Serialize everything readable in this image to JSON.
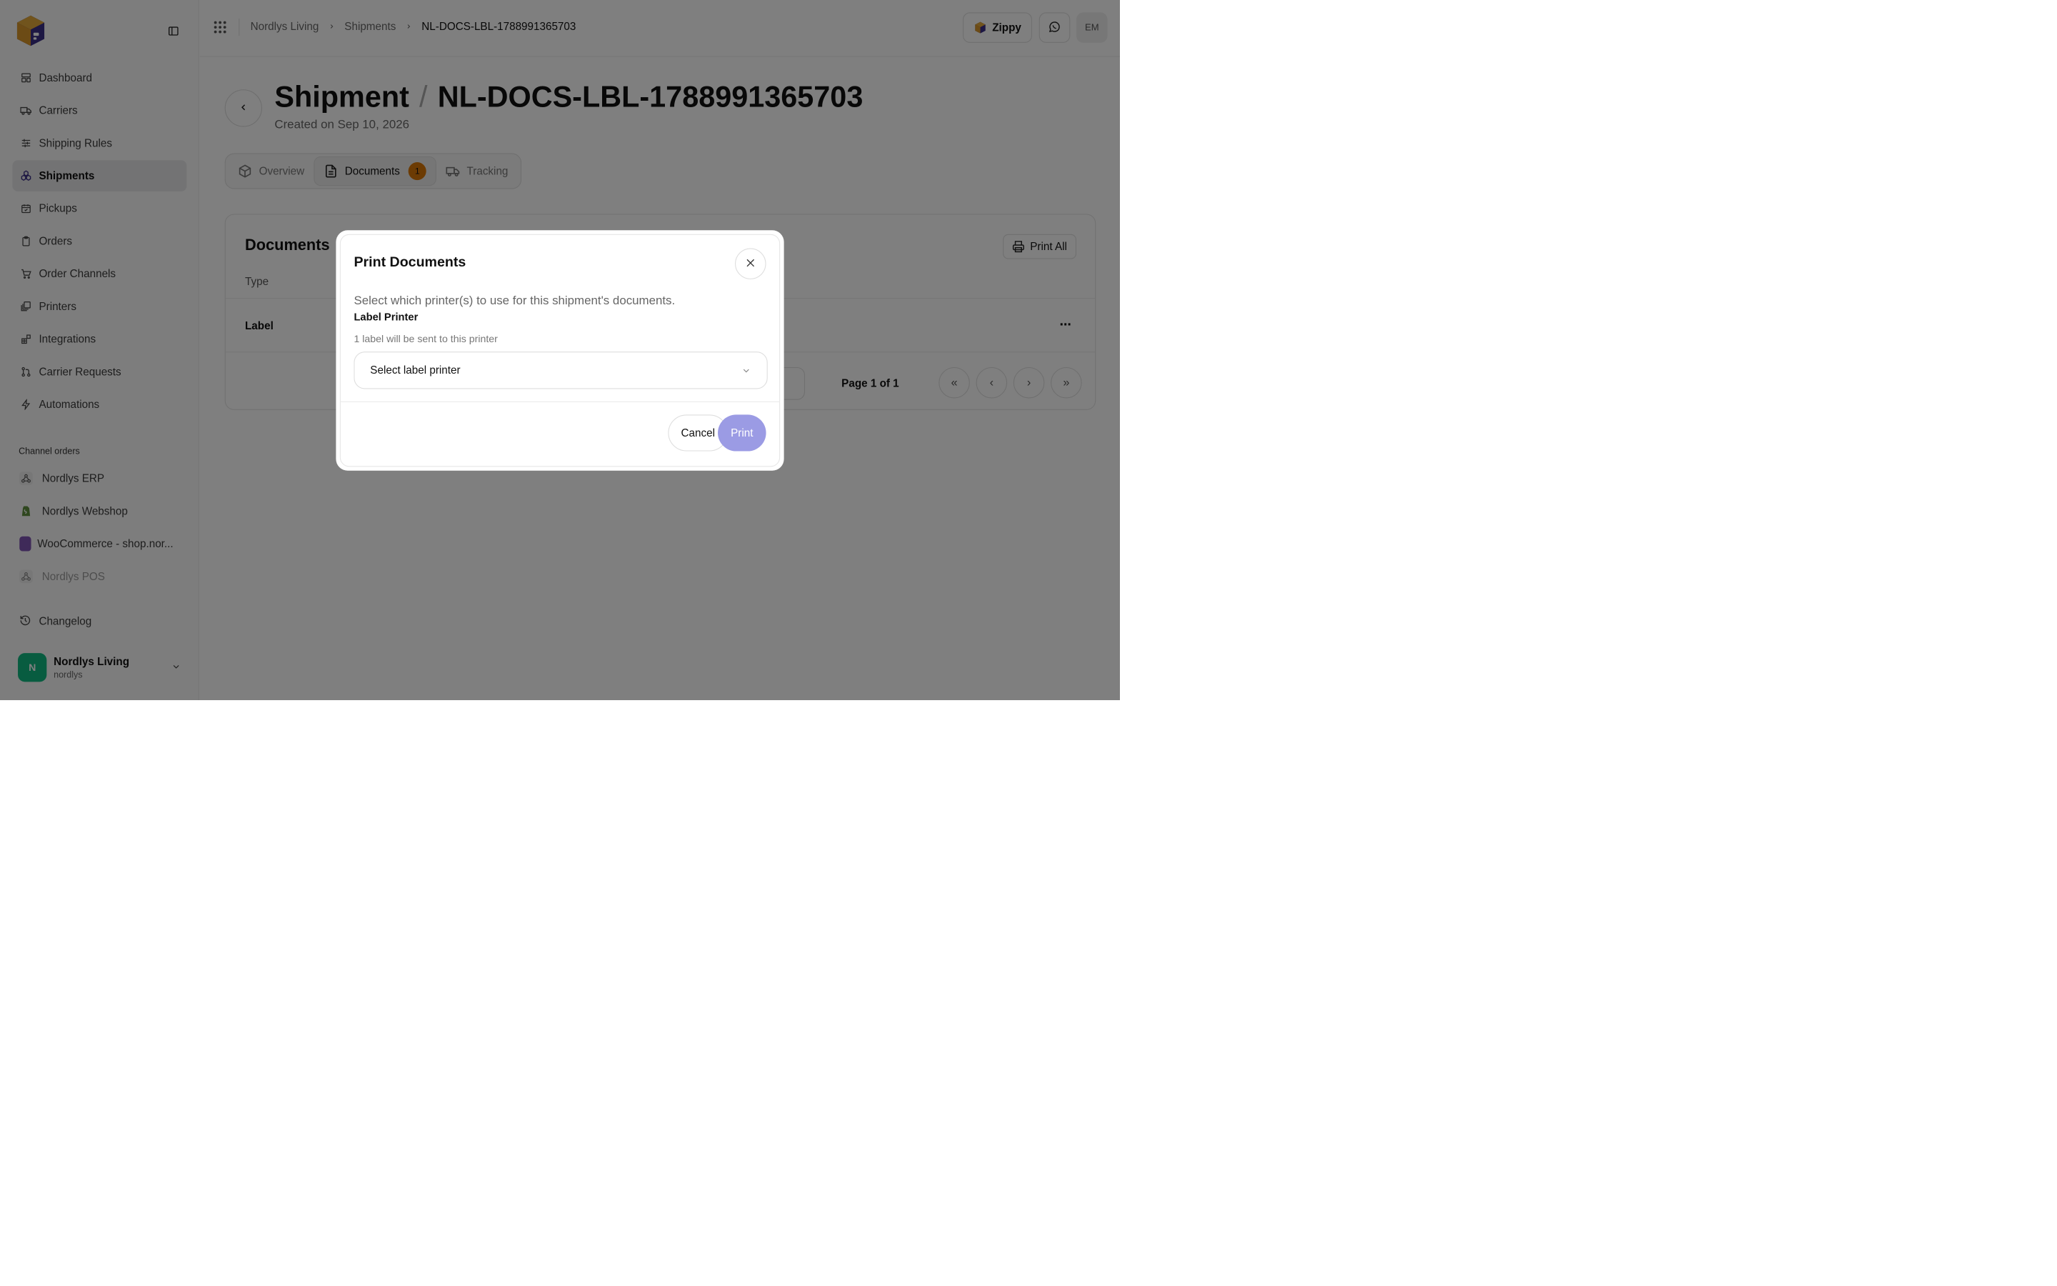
{
  "sidebar": {
    "items": [
      {
        "label": "Dashboard",
        "icon": "dashboard-icon"
      },
      {
        "label": "Carriers",
        "icon": "truck-icon"
      },
      {
        "label": "Shipping Rules",
        "icon": "sliders-icon"
      },
      {
        "label": "Shipments",
        "icon": "shipments-icon"
      },
      {
        "label": "Pickups",
        "icon": "calendar-icon"
      },
      {
        "label": "Orders",
        "icon": "clipboard-icon"
      },
      {
        "label": "Order Channels",
        "icon": "cart-icon"
      },
      {
        "label": "Printers",
        "icon": "printers-icon"
      },
      {
        "label": "Integrations",
        "icon": "integrations-icon"
      },
      {
        "label": "Carrier Requests",
        "icon": "git-pull-icon"
      },
      {
        "label": "Automations",
        "icon": "lightning-icon"
      }
    ],
    "channels_label": "Channel orders",
    "channels": [
      {
        "label": "Nordlys ERP",
        "icon": "webhook-icon"
      },
      {
        "label": "Nordlys Webshop",
        "icon": "shopify-icon"
      },
      {
        "label": "WooCommerce - shop.nor...",
        "icon": "woocommerce-icon"
      },
      {
        "label": "Nordlys POS",
        "icon": "webhook-icon"
      }
    ],
    "changelog": "Changelog",
    "account": {
      "initial": "N",
      "name": "Nordlys Living",
      "handle": "nordlys"
    }
  },
  "topbar": {
    "breadcrumb": [
      "Nordlys Living",
      "Shipments",
      "NL-DOCS-LBL-1788991365703"
    ],
    "brand_button": "Zippy",
    "user_initials": "EM"
  },
  "page": {
    "title_prefix": "Shipment",
    "title_separator": "/",
    "title_id": "NL-DOCS-LBL-1788991365703",
    "created": "Created on Sep 10, 2026",
    "tabs": [
      {
        "label": "Overview",
        "icon": "box-icon"
      },
      {
        "label": "Documents",
        "icon": "document-icon",
        "badge": "1"
      },
      {
        "label": "Tracking",
        "icon": "truck-icon"
      }
    ]
  },
  "documents": {
    "title": "Documents",
    "print_all": "Print All",
    "columns": [
      "Type"
    ],
    "rows": [
      {
        "type": "Label"
      }
    ],
    "pagination": "Page 1 of 1"
  },
  "modal": {
    "title": "Print Documents",
    "description": "Select which printer(s) to use for this shipment's documents.",
    "field_label": "Label Printer",
    "field_hint": "1 label will be sent to this printer",
    "select_placeholder": "Select label printer",
    "cancel": "Cancel",
    "print": "Print"
  },
  "colors": {
    "accent": "#9b9be4",
    "badge": "#d97706",
    "avatar": "#10b981",
    "overlay": "rgba(0,0,0,0.5)"
  }
}
